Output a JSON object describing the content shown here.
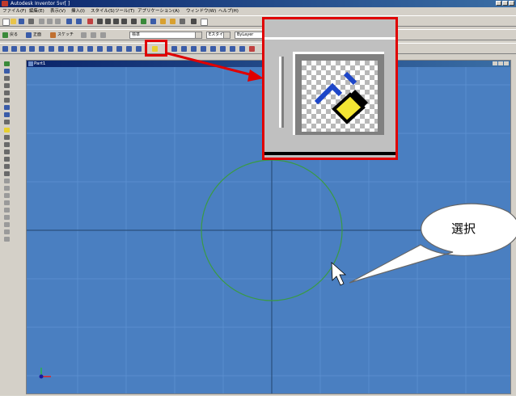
{
  "window": {
    "title": "Autodesk Inventor 5vr[ ]"
  },
  "menubar": {
    "items": [
      "ファイル(F)",
      "編集(E)",
      "表示(V)",
      "挿入(I)",
      "スタイル(S)",
      "ツール(T)",
      "アプリケーション(A)",
      "ウィンドウ(W)",
      "ヘルプ(H)"
    ]
  },
  "toolbar2": {
    "item_a": "戻る",
    "item_b": "正面",
    "item_c": "スケッチ",
    "combo_1": "標準",
    "combo_2": "Eスタイル",
    "combo_3": "ByLayer"
  },
  "document": {
    "title": "Part1"
  },
  "callout": {
    "label": "選択"
  },
  "colors": {
    "accent": "#e00000",
    "canvas": "#4a7fc1",
    "circle": "#3a9a44",
    "callout_fill": "#ffffff"
  },
  "icons": [
    "app-icon",
    "sketch-select-icon",
    "cursor-arrow-icon",
    "axis-indicator-icon"
  ]
}
